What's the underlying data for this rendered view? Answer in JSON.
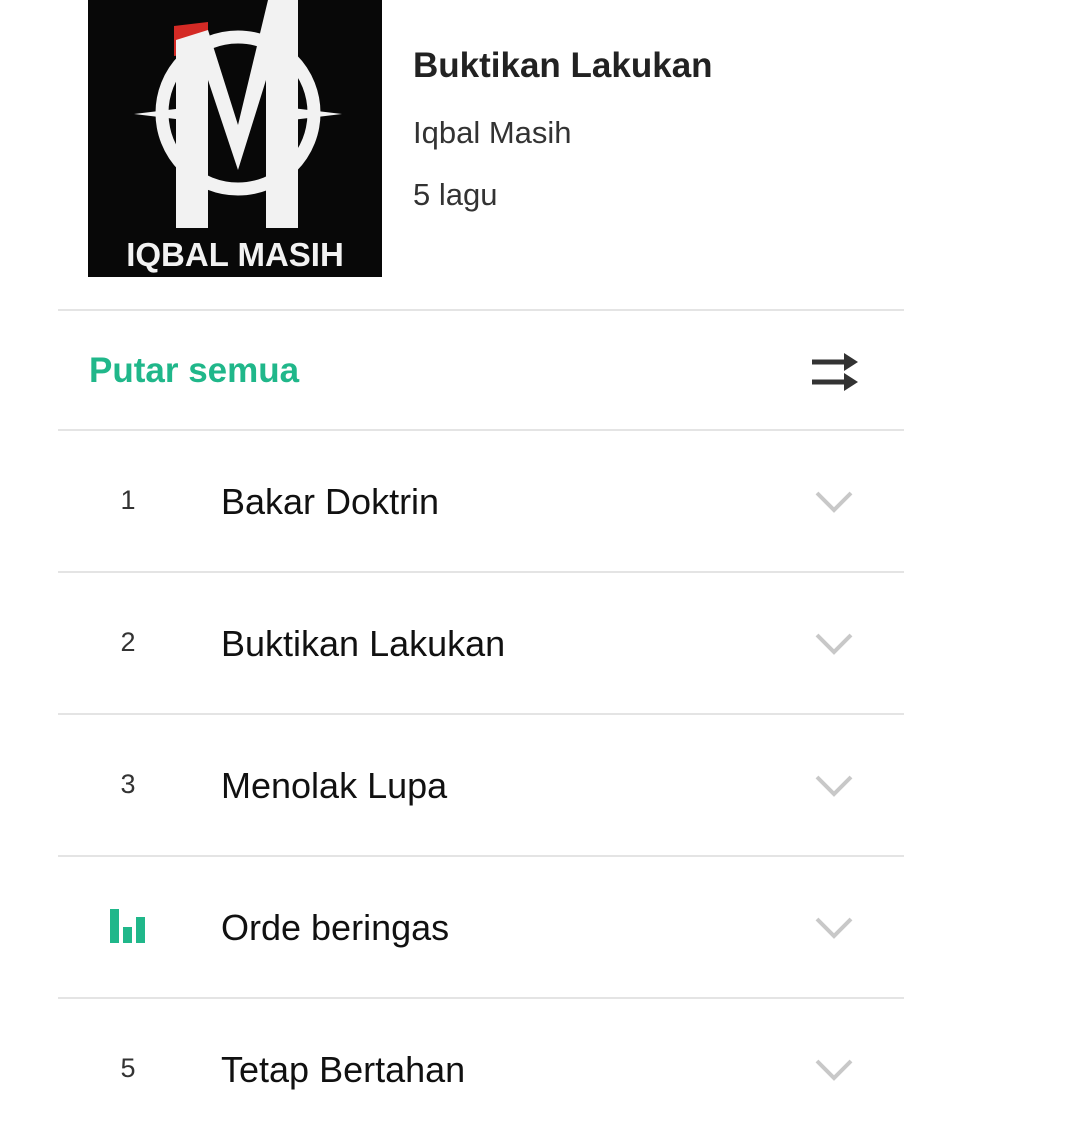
{
  "album": {
    "title": "Buktikan Lakukan",
    "artist": "Iqbal Masih",
    "track_count": "5 lagu",
    "cover_text": "IQBAL MASIH",
    "cover_letter": "M"
  },
  "actions": {
    "play_all_label": "Putar semua",
    "shuffle_icon": "shuffle-icon"
  },
  "tracks": [
    {
      "number": "1",
      "title": "Bakar Doktrin",
      "playing": false
    },
    {
      "number": "2",
      "title": "Buktikan Lakukan",
      "playing": false
    },
    {
      "number": "3",
      "title": "Menolak Lupa",
      "playing": false
    },
    {
      "number": "",
      "title": "Orde beringas",
      "playing": true
    },
    {
      "number": "5",
      "title": "Tetap Bertahan",
      "playing": false
    }
  ],
  "colors": {
    "accent": "#20b78a",
    "divider": "#e4e4e4",
    "chevron": "#c8c8c8",
    "cover_bg": "#080808",
    "cover_red": "#d42a25"
  }
}
